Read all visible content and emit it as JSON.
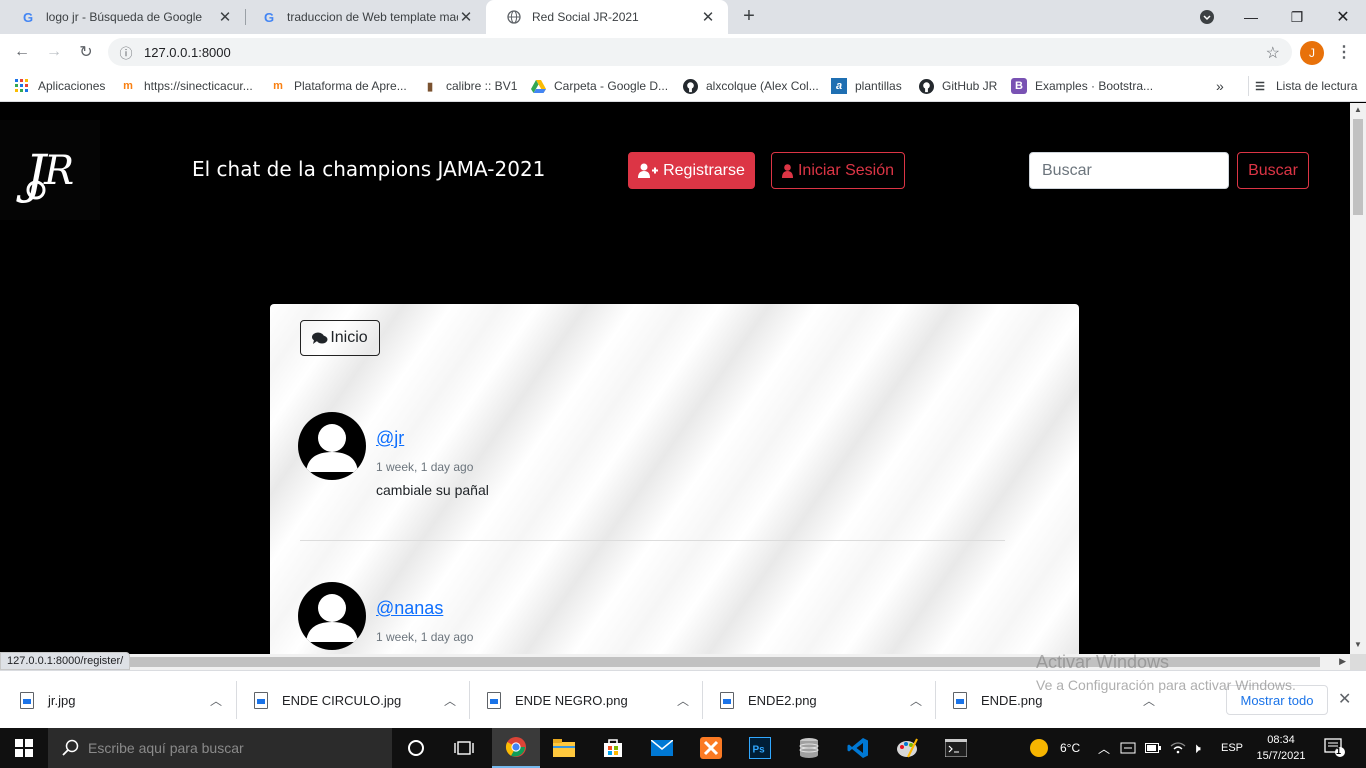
{
  "browser": {
    "tabs": [
      {
        "title": "logo jr - Búsqueda de Google",
        "active": false
      },
      {
        "title": "traduccion de Web template mad",
        "active": false
      },
      {
        "title": "Red Social JR-2021",
        "active": true
      }
    ],
    "url": "127.0.0.1:8000",
    "profile_initial": "J",
    "bookmarks": [
      "Aplicaciones",
      "https://sinecticacur...",
      "Plataforma de Apre...",
      "calibre :: BV1",
      "Carpeta - Google D...",
      "alxcolque (Alex Col...",
      "plantillas",
      "GitHub JR",
      "Examples · Bootstra..."
    ],
    "reading_list": "Lista de lectura",
    "status_url": "127.0.0.1:8000/register/"
  },
  "site": {
    "logo_text": "JR",
    "title": "El chat de la champions JAMA-2021",
    "register_label": "Registrarse",
    "login_label": "Iniciar Sesión",
    "search_placeholder": "Buscar",
    "search_button": "Buscar",
    "accent_color": "#dc3545",
    "home_button": "Inicio",
    "posts": [
      {
        "handle": "@jr",
        "time": "1 week, 1 day ago",
        "message": "cambiale su pañal"
      },
      {
        "handle": "@nanas",
        "time": "1 week, 1 day ago",
        "message": ""
      }
    ]
  },
  "downloads": {
    "items": [
      "jr.jpg",
      "ENDE CIRCULO.jpg",
      "ENDE NEGRO.png",
      "ENDE2.png",
      "ENDE.png"
    ],
    "show_all": "Mostrar todo"
  },
  "watermark": {
    "line1": "Activar Windows",
    "line2": "Ve a Configuración para activar Windows."
  },
  "taskbar": {
    "search_placeholder": "Escribe aquí para buscar",
    "weather": "6°C",
    "language": "ESP",
    "time": "08:34",
    "date": "15/7/2021",
    "notifications": "1"
  }
}
